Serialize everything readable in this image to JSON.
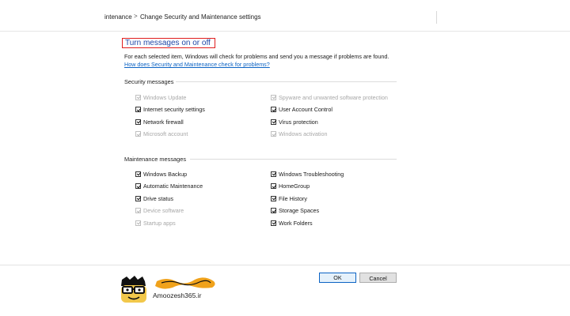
{
  "breadcrumb": {
    "parent": "intenance",
    "separator": ">",
    "current": "Change Security and Maintenance settings"
  },
  "title": "Turn messages on or off",
  "description": "For each selected item, Windows will check for problems and send you a message if problems are found.",
  "help_link": "How does Security and Maintenance check for problems?",
  "security": {
    "title": "Security messages",
    "items": [
      {
        "label": "Windows Update",
        "checked": true,
        "disabled": true
      },
      {
        "label": "Spyware and unwanted software protection",
        "checked": true,
        "disabled": true
      },
      {
        "label": "Internet security settings",
        "checked": true,
        "disabled": false
      },
      {
        "label": "User Account Control",
        "checked": true,
        "disabled": false
      },
      {
        "label": "Network firewall",
        "checked": true,
        "disabled": false
      },
      {
        "label": "Virus protection",
        "checked": true,
        "disabled": false
      },
      {
        "label": "Microsoft account",
        "checked": true,
        "disabled": true
      },
      {
        "label": "Windows activation",
        "checked": true,
        "disabled": true
      }
    ]
  },
  "maintenance": {
    "title": "Maintenance messages",
    "items": [
      {
        "label": "Windows Backup",
        "checked": true,
        "disabled": false
      },
      {
        "label": "Windows Troubleshooting",
        "checked": true,
        "disabled": false
      },
      {
        "label": "Automatic Maintenance",
        "checked": true,
        "disabled": false
      },
      {
        "label": "HomeGroup",
        "checked": true,
        "disabled": false
      },
      {
        "label": "Drive status",
        "checked": true,
        "disabled": false
      },
      {
        "label": "File History",
        "checked": true,
        "disabled": false
      },
      {
        "label": "Device software",
        "checked": true,
        "disabled": true
      },
      {
        "label": "Storage Spaces",
        "checked": true,
        "disabled": false
      },
      {
        "label": "Startup apps",
        "checked": true,
        "disabled": true
      },
      {
        "label": "Work Folders",
        "checked": true,
        "disabled": false
      }
    ]
  },
  "buttons": {
    "ok": "OK",
    "cancel": "Cancel"
  },
  "watermark": {
    "text": "Amoozesh365.ir",
    "logo_lettering": "آموزش ۳۶۵"
  },
  "colors": {
    "title_border": "#e01e1e",
    "title_text": "#1f47a8",
    "link": "#0b63c4",
    "ok_border": "#0b63c4"
  }
}
